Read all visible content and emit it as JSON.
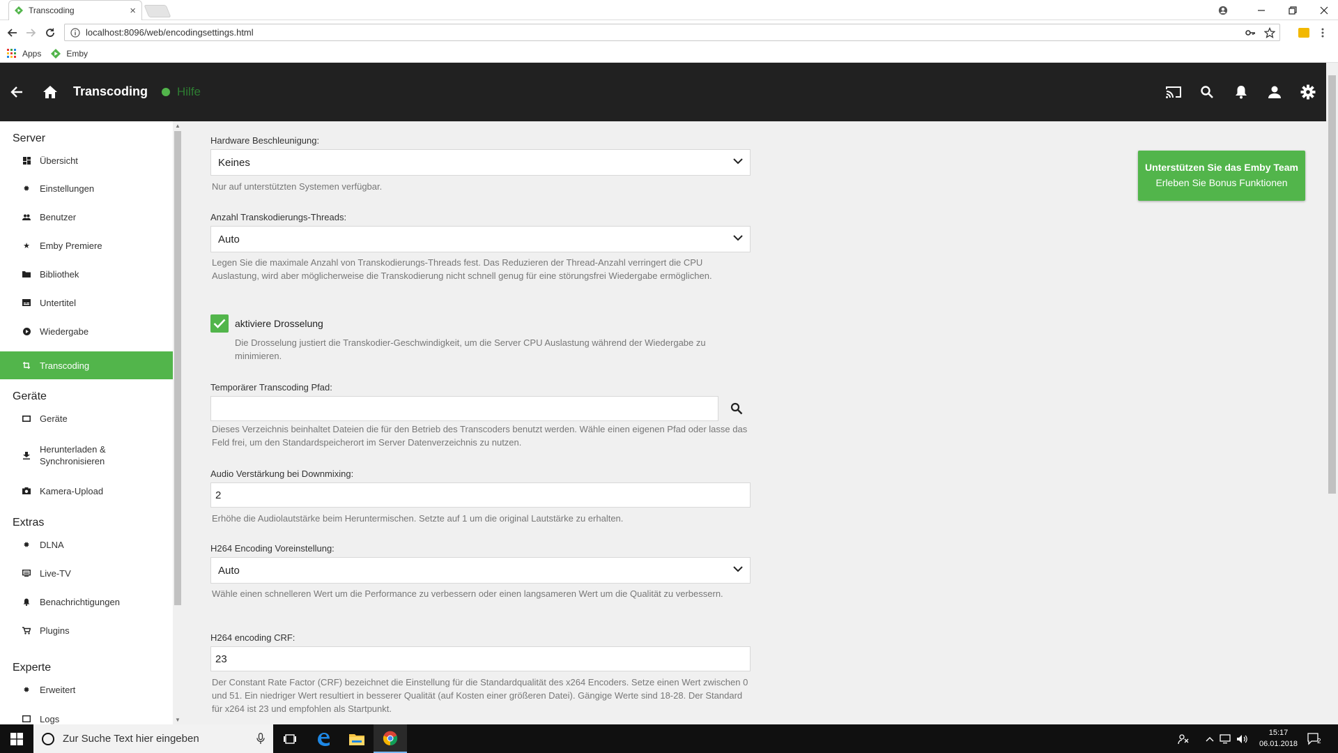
{
  "browser": {
    "tab_title": "Transcoding",
    "tab_close": "×",
    "url": "localhost:8096/web/encodingsettings.html",
    "bookmarks": [
      {
        "label": "Apps",
        "icon": "apps-grid-icon"
      },
      {
        "label": "Emby",
        "icon": "emby-logo-icon"
      }
    ]
  },
  "header": {
    "title": "Transcoding",
    "help_label": "Hilfe"
  },
  "sidebar": {
    "sections": [
      {
        "title": "Server",
        "items": [
          {
            "label": "Übersicht",
            "icon": "dashboard-icon"
          },
          {
            "label": "Einstellungen",
            "icon": "settings-icon"
          },
          {
            "label": "Benutzer",
            "icon": "people-icon"
          },
          {
            "label": "Emby Premiere",
            "icon": "star-icon"
          },
          {
            "label": "Bibliothek",
            "icon": "folder-icon"
          },
          {
            "label": "Untertitel",
            "icon": "subtitles-icon"
          },
          {
            "label": "Wiedergabe",
            "icon": "play-circle-icon"
          },
          {
            "label": "Transcoding",
            "icon": "transform-icon",
            "active": true
          }
        ]
      },
      {
        "title": "Geräte",
        "items": [
          {
            "label": "Geräte",
            "icon": "tablet-icon"
          },
          {
            "label": "Herunterladen & Synchronisieren",
            "icon": "download-icon"
          },
          {
            "label": "Kamera-Upload",
            "icon": "camera-icon"
          }
        ]
      },
      {
        "title": "Extras",
        "items": [
          {
            "label": "DLNA",
            "icon": "settings-icon"
          },
          {
            "label": "Live-TV",
            "icon": "tv-icon"
          },
          {
            "label": "Benachrichtigungen",
            "icon": "bell-icon"
          },
          {
            "label": "Plugins",
            "icon": "cart-icon"
          }
        ]
      },
      {
        "title": "Experte",
        "items": [
          {
            "label": "Erweitert",
            "icon": "settings-icon"
          },
          {
            "label": "Logs",
            "icon": "logs-icon"
          }
        ]
      }
    ]
  },
  "form": {
    "hw_accel": {
      "label": "Hardware Beschleunigung:",
      "value": "Keines",
      "help": "Nur auf unterstützten Systemen verfügbar."
    },
    "threads": {
      "label": "Anzahl Transkodierungs-Threads:",
      "value": "Auto",
      "help": "Legen Sie die maximale Anzahl von Transkodierungs-Threads fest. Das Reduzieren der Thread-Anzahl verringert die CPU Auslastung, wird aber möglicherweise die Transkodierung nicht schnell genug für eine störungsfrei Wiedergabe ermöglichen."
    },
    "throttle": {
      "label": "aktiviere Drosselung",
      "checked": true,
      "help": "Die Drosselung justiert die Transkodier-Geschwindigkeit, um die Server CPU Auslastung während der Wiedergabe zu minimieren."
    },
    "temp_path": {
      "label": "Temporärer Transcoding Pfad:",
      "value": "",
      "help": "Dieses Verzeichnis beinhaltet Dateien die für den Betrieb des Transcoders benutzt werden. Wähle einen eigenen Pfad oder lasse das Feld frei, um den Standardspeicherort im Server Datenverzeichnis zu nutzen."
    },
    "downmix": {
      "label": "Audio Verstärkung bei Downmixing:",
      "value": "2",
      "help": "Erhöhe die Audiolautstärke beim Heruntermischen. Setzte auf 1 um die original Lautstärke zu erhalten."
    },
    "h264_preset": {
      "label": "H264 Encoding Voreinstellung:",
      "value": "Auto",
      "help": "Wähle einen schnelleren Wert um die Performance zu verbessern oder einen langsameren Wert um die Qualität zu verbessern."
    },
    "h264_crf": {
      "label": "H264 encoding CRF:",
      "value": "23",
      "help": "Der Constant Rate Factor (CRF) bezeichnet die Einstellung für die Standardqualität des x264 Encoders. Setze einen Wert zwischen 0 und 51. Ein niedriger Wert resultiert in besserer Qualität (auf Kosten einer größeren Datei). Gängige Werte sind 18-28. Der Standard für x264 ist 23 und empfohlen als Startpunkt."
    }
  },
  "promo": {
    "line1": "Unterstützen Sie das Emby Team",
    "line2": "Erleben Sie Bonus Funktionen"
  },
  "taskbar": {
    "search_placeholder": "Zur Suche Text hier eingeben",
    "time": "15:17",
    "date": "06.01.2018",
    "notifications": "2"
  },
  "colors": {
    "accent": "#52b54b",
    "header_bg": "#212121",
    "content_bg": "#f0f0f0"
  }
}
